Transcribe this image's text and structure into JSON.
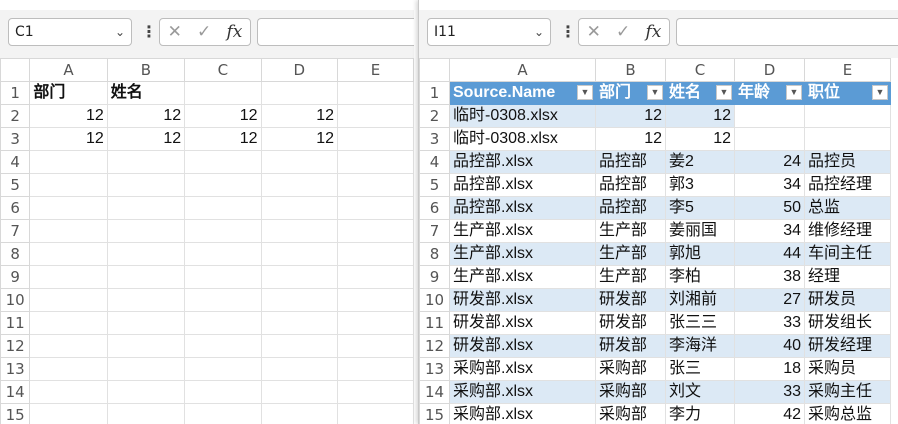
{
  "left": {
    "namebox": "C1",
    "columns": [
      "A",
      "B",
      "C",
      "D",
      "E"
    ],
    "rows": [
      {
        "n": "1",
        "cells": [
          "部门",
          "姓名",
          "",
          "",
          ""
        ]
      },
      {
        "n": "2",
        "cells": [
          "12",
          "12",
          "12",
          "12",
          ""
        ]
      },
      {
        "n": "3",
        "cells": [
          "12",
          "12",
          "12",
          "12",
          ""
        ]
      },
      {
        "n": "4",
        "cells": [
          "",
          "",
          "",
          "",
          ""
        ]
      },
      {
        "n": "5",
        "cells": [
          "",
          "",
          "",
          "",
          ""
        ]
      },
      {
        "n": "6",
        "cells": [
          "",
          "",
          "",
          "",
          ""
        ]
      },
      {
        "n": "7",
        "cells": [
          "",
          "",
          "",
          "",
          ""
        ]
      },
      {
        "n": "8",
        "cells": [
          "",
          "",
          "",
          "",
          ""
        ]
      },
      {
        "n": "9",
        "cells": [
          "",
          "",
          "",
          "",
          ""
        ]
      },
      {
        "n": "10",
        "cells": [
          "",
          "",
          "",
          "",
          ""
        ]
      },
      {
        "n": "11",
        "cells": [
          "",
          "",
          "",
          "",
          ""
        ]
      },
      {
        "n": "12",
        "cells": [
          "",
          "",
          "",
          "",
          ""
        ]
      },
      {
        "n": "13",
        "cells": [
          "",
          "",
          "",
          "",
          ""
        ]
      },
      {
        "n": "14",
        "cells": [
          "",
          "",
          "",
          "",
          ""
        ]
      },
      {
        "n": "15",
        "cells": [
          "",
          "",
          "",
          "",
          ""
        ]
      }
    ]
  },
  "right": {
    "namebox": "I11",
    "columns": [
      "A",
      "B",
      "C",
      "D",
      "E"
    ],
    "headers": [
      "Source.Name",
      "部门",
      "姓名",
      "年龄",
      "职位"
    ],
    "rows": [
      {
        "n": "2",
        "cells": [
          "临时-0308.xlsx",
          "12",
          "12",
          "",
          ""
        ]
      },
      {
        "n": "3",
        "cells": [
          "临时-0308.xlsx",
          "12",
          "12",
          "",
          ""
        ]
      },
      {
        "n": "4",
        "cells": [
          "品控部.xlsx",
          "品控部",
          "姜2",
          "24",
          "品控员"
        ]
      },
      {
        "n": "5",
        "cells": [
          "品控部.xlsx",
          "品控部",
          "郭3",
          "34",
          "品控经理"
        ]
      },
      {
        "n": "6",
        "cells": [
          "品控部.xlsx",
          "品控部",
          "李5",
          "50",
          "总监"
        ]
      },
      {
        "n": "7",
        "cells": [
          "生产部.xlsx",
          "生产部",
          "姜丽国",
          "34",
          "维修经理"
        ]
      },
      {
        "n": "8",
        "cells": [
          "生产部.xlsx",
          "生产部",
          "郭旭",
          "44",
          "车间主任"
        ]
      },
      {
        "n": "9",
        "cells": [
          "生产部.xlsx",
          "生产部",
          "李柏",
          "38",
          "经理"
        ]
      },
      {
        "n": "10",
        "cells": [
          "研发部.xlsx",
          "研发部",
          "刘湘前",
          "27",
          "研发员"
        ]
      },
      {
        "n": "11",
        "cells": [
          "研发部.xlsx",
          "研发部",
          "张三三",
          "33",
          "研发组长"
        ]
      },
      {
        "n": "12",
        "cells": [
          "研发部.xlsx",
          "研发部",
          "李海洋",
          "40",
          "研发经理"
        ]
      },
      {
        "n": "13",
        "cells": [
          "采购部.xlsx",
          "采购部",
          "张三",
          "18",
          "采购员"
        ]
      },
      {
        "n": "14",
        "cells": [
          "采购部.xlsx",
          "采购部",
          "刘文",
          "33",
          "采购主任"
        ]
      },
      {
        "n": "15",
        "cells": [
          "采购部.xlsx",
          "采购部",
          "李力",
          "42",
          "采购总监"
        ]
      }
    ]
  },
  "formula": {
    "fx_label": "fx"
  }
}
